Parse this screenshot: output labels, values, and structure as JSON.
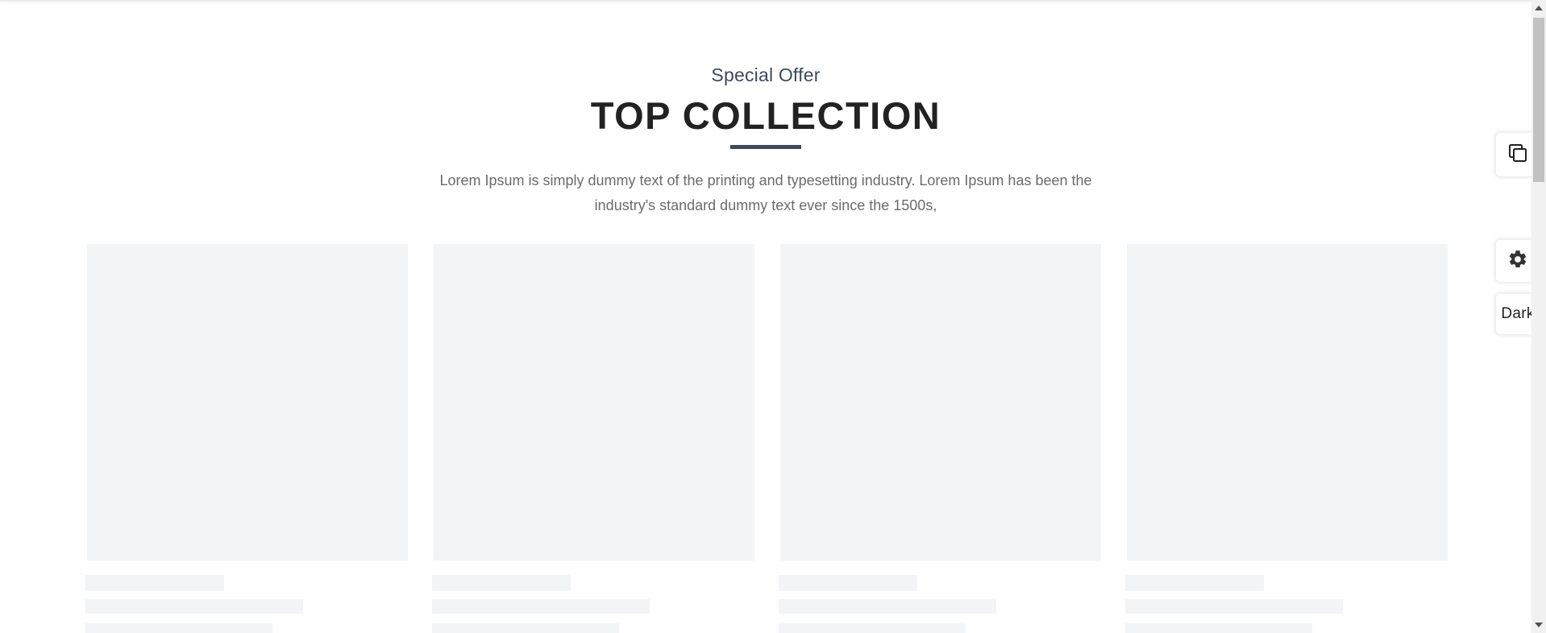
{
  "section": {
    "subtitle": "Special Offer",
    "title": "TOP COLLECTION",
    "description": "Lorem Ipsum is simply dummy text of the printing and typesetting industry. Lorem Ipsum has been the industry's standard dummy text ever since the 1500s,"
  },
  "products": [
    {
      "state": "loading"
    },
    {
      "state": "loading"
    },
    {
      "state": "loading"
    },
    {
      "state": "loading"
    }
  ],
  "side_panel": {
    "copy_icon": "copy-icon",
    "settings_icon": "gear-icon",
    "dark_label": "Dark"
  },
  "colors": {
    "accent": "#3c4a5e",
    "title": "#222222",
    "skeleton": "#f3f4f6"
  }
}
